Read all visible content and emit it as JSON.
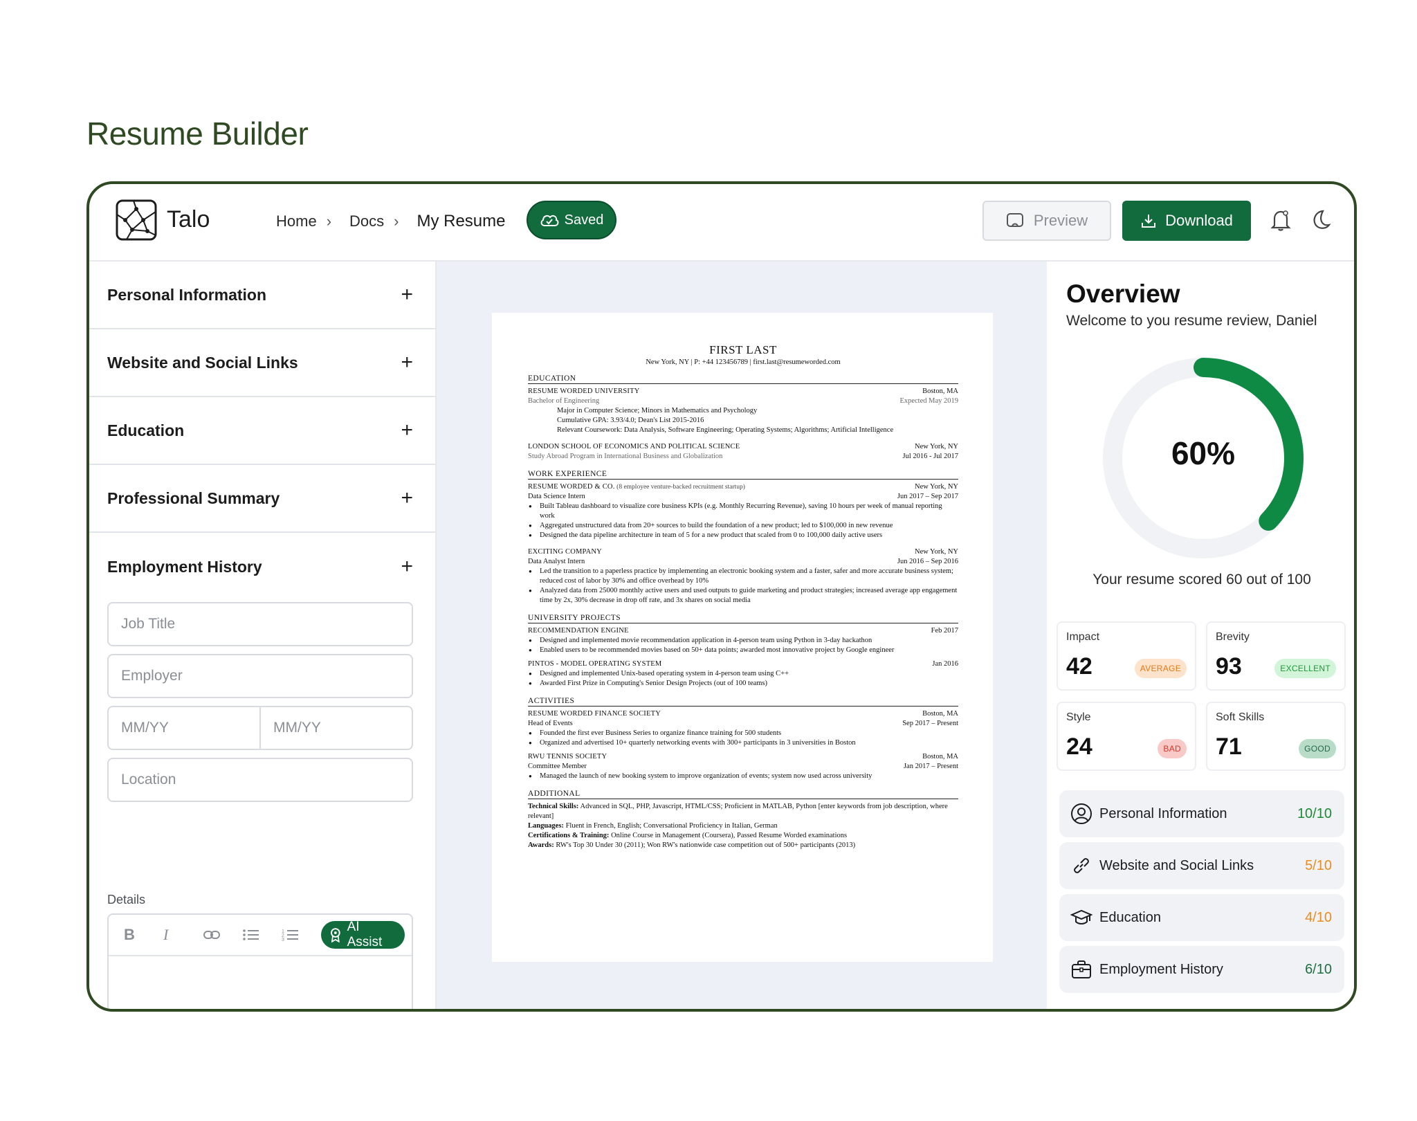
{
  "page": {
    "title": "Resume Builder"
  },
  "header": {
    "brand": "Talo",
    "breadcrumbs": [
      "Home",
      "Docs",
      "My Resume"
    ],
    "saved_label": "Saved",
    "preview_label": "Preview",
    "download_label": "Download"
  },
  "left": {
    "sections": [
      "Personal Information",
      "Website and Social Links",
      "Education",
      "Professional Summary",
      "Employment History"
    ],
    "fields": {
      "job_title": "Job Title",
      "employer": "Employer",
      "start_date": "MM/YY",
      "end_date": "MM/YY",
      "location": "Location"
    },
    "details_label": "Details",
    "toolbar": {
      "bold": "B",
      "italic": "I",
      "ai_assist": "AI Assist"
    }
  },
  "resume": {
    "name": "FIRST LAST",
    "contact": "New York, NY | P: +44 123456789 | first.last@resumeworded.com",
    "education": {
      "title": "EDUCATION",
      "entries": [
        {
          "org": "RESUME WORDED UNIVERSITY",
          "location": "Boston, MA",
          "sub": "Bachelor of Engineering",
          "date": "Expected May 2019",
          "lines": [
            "Major in Computer Science; Minors in Mathematics and Psychology",
            "Cumulative GPA: 3.93/4.0; Dean's List 2015-2016",
            "Relevant Coursework: Data Analysis, Software Engineering; Operating Systems; Algorithms; Artificial Intelligence"
          ]
        },
        {
          "org": "LONDON SCHOOL OF ECONOMICS AND POLITICAL SCIENCE",
          "location": "New York, NY",
          "sub": "Study Abroad Program in International Business and Globalization",
          "date": "Jul 2016 - Jul 2017"
        }
      ]
    },
    "work": {
      "title": "WORK EXPERIENCE",
      "entries": [
        {
          "org": "RESUME WORDED & CO.",
          "org_note": "(8 employee venture-backed recruitment startup)",
          "location": "New York, NY",
          "role": "Data Science Intern",
          "date": "Jun 2017 – Sep 2017",
          "bullets": [
            "Built Tableau dashboard to visualize core business KPIs (e.g. Monthly Recurring Revenue), saving 10 hours per week of manual reporting work",
            "Aggregated unstructured data from 20+ sources to build the foundation of a new product; led to $100,000 in new revenue",
            "Designed the data pipeline architecture in team of 5 for a new product that scaled from 0 to 100,000 daily active users"
          ]
        },
        {
          "org": "EXCITING COMPANY",
          "location": "New York, NY",
          "role": "Data Analyst Intern",
          "date": "Jun 2016 – Sep 2016",
          "bullets": [
            "Led the transition to a paperless practice by implementing an electronic booking system and a faster, safer and more accurate business system; reduced cost of labor by 30% and office overhead by 10%",
            "Analyzed data from 25000 monthly active users and used outputs to guide marketing and product strategies; increased average app engagement time by 2x, 30% decrease in drop off rate, and 3x shares on social media"
          ]
        }
      ]
    },
    "projects": {
      "title": "UNIVERSITY PROJECTS",
      "entries": [
        {
          "org": "RECOMMENDATION ENGINE",
          "date": "Feb 2017",
          "bullets": [
            "Designed and implemented movie recommendation application in 4-person team using Python in 3-day hackathon",
            "Enabled users to be recommended movies based on 50+ data points; awarded most innovative project by Google engineer"
          ]
        },
        {
          "org": "PINTOS - MODEL OPERATING SYSTEM",
          "date": "Jan 2016",
          "bullets": [
            "Designed and implemented Unix-based operating system in 4-person team using C++",
            "Awarded First Prize in Computing's Senior Design Projects (out of 100 teams)"
          ]
        }
      ]
    },
    "activities": {
      "title": "ACTIVITIES",
      "entries": [
        {
          "org": "RESUME WORDED FINANCE SOCIETY",
          "location": "Boston, MA",
          "role": "Head of Events",
          "date": "Sep 2017 – Present",
          "bullets": [
            "Founded the first ever Business Series to organize finance training for 500 students",
            "Organized and advertised 10+ quarterly networking events with 300+ participants in 3 universities in Boston"
          ]
        },
        {
          "org": "RWU TENNIS SOCIETY",
          "location": "Boston, MA",
          "role": "Committee Member",
          "date": "Jan 2017 – Present",
          "bullets": [
            "Managed the launch of new booking system to improve organization of events; system now used across university"
          ]
        }
      ]
    },
    "additional": {
      "title": "ADDITIONAL",
      "lines": [
        {
          "label": "Technical Skills:",
          "text": " Advanced in SQL, PHP, Javascript, HTML/CSS; Proficient in MATLAB, Python [enter keywords from job description, where relevant]"
        },
        {
          "label": "Languages:",
          "text": " Fluent in French, English; Conversational Proficiency in Italian, German"
        },
        {
          "label": "Certifications & Training:",
          "text": " Online Course in Management (Coursera), Passed Resume Worded examinations"
        },
        {
          "label": "Awards:",
          "text": " RW's Top 30 Under 30 (2011); Won RW's nationwide case competition out of 500+ participants (2013)"
        }
      ]
    }
  },
  "overview": {
    "title": "Overview",
    "welcome": "Welcome to you resume review, Daniel",
    "score_percent": 60,
    "score_label": "60%",
    "score_text": "Your resume scored 60 out of 100",
    "metrics": [
      {
        "label": "Impact",
        "value": "42",
        "badge": "AVERAGE",
        "badge_bg": "#fde3cc",
        "badge_fg": "#e07a16"
      },
      {
        "label": "Brevity",
        "value": "93",
        "badge": "EXCELLENT",
        "badge_bg": "#d2f5d9",
        "badge_fg": "#1a9a36"
      },
      {
        "label": "Style",
        "value": "24",
        "badge": "BAD",
        "badge_bg": "#f8c9c6",
        "badge_fg": "#d9372b"
      },
      {
        "label": "Soft Skills",
        "value": "71",
        "badge": "GOOD",
        "badge_bg": "#b8dcc8",
        "badge_fg": "#25684a"
      }
    ],
    "sections": [
      {
        "label": "Personal Information",
        "score": "10/10",
        "color": "#1e8a35",
        "icon": "user-circle-icon"
      },
      {
        "label": "Website and Social Links",
        "score": "5/10",
        "color": "#ea8c1e",
        "icon": "link-icon"
      },
      {
        "label": "Education",
        "score": "4/10",
        "color": "#ea8c1e",
        "icon": "graduation-cap-icon"
      },
      {
        "label": "Employment History",
        "score": "6/10",
        "color": "#1e6f3f",
        "icon": "briefcase-icon"
      }
    ]
  },
  "colors": {
    "brand_green": "#116b3c",
    "frame_green": "#2f4a22",
    "gauge_track": "#f1f2f5"
  }
}
